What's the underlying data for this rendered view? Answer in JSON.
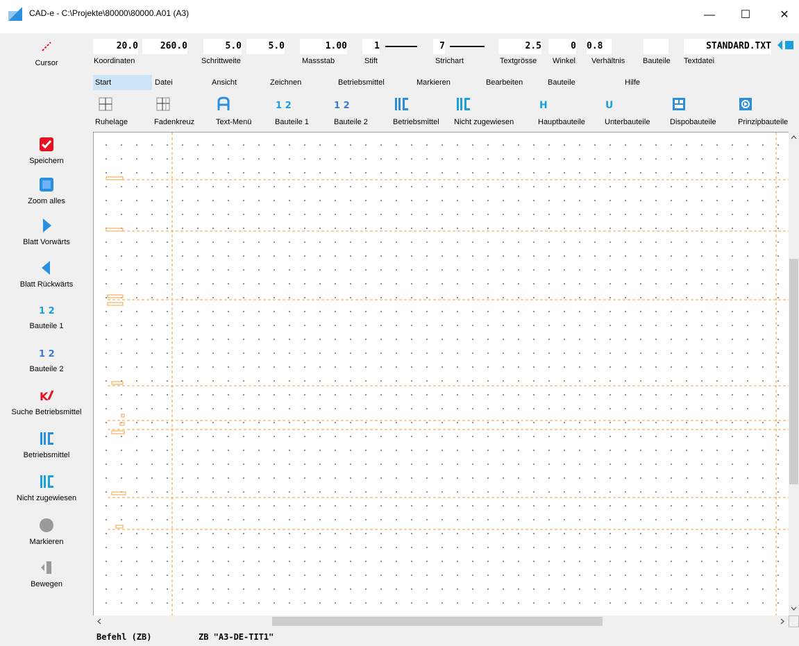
{
  "window": {
    "title": "CAD-e - C:\\Projekte\\80000\\80000.A01 (A3)",
    "minimize": "—",
    "maximize": "☐",
    "close": "✕"
  },
  "params": {
    "koordinaten_x": "20.0",
    "koordinaten_y": "260.0",
    "schrittweite_x": "5.0",
    "schrittweite_y": "5.0",
    "massstab": "1.00",
    "stift": "1",
    "strichart": "7",
    "textgroesse": "2.5",
    "winkel": "0",
    "verhaeltnis": "0.8",
    "bauteile": "",
    "textdatei": "STANDARD.TXT"
  },
  "param_labels": {
    "koordinaten": "Koordinaten",
    "schrittweite": "Schrittweite",
    "massstab": "Massstab",
    "stift": "Stift",
    "strichart": "Strichart",
    "textgroesse": "Textgrösse",
    "winkel": "Winkel",
    "verhaeltnis": "Verhältnis",
    "bauteile": "Bauteile",
    "textdatei": "Textdatei"
  },
  "cursor_label": "Cursor",
  "menu": [
    "Start",
    "Datei",
    "Ansicht",
    "Zeichnen",
    "Betriebsmittel",
    "Markieren",
    "Bearbeiten",
    "Bauteile",
    "Hilfe"
  ],
  "toolbar": [
    "Ruhelage",
    "Fadenkreuz",
    "Text-Menü",
    "Bauteile 1",
    "Bauteile 2",
    "Betriebsmittel",
    "Nicht zugewiesen",
    "Hauptbauteile",
    "Unterbauteile",
    "Dispobauteile",
    "Prinzipbauteile"
  ],
  "toolbar_glyphs": {
    "bauteile1": "1 2",
    "bauteile2": "1 2",
    "hauptbauteile": "H",
    "unterbauteile": "U"
  },
  "sidebar": [
    "Speichern",
    "Zoom alles",
    "Blatt Vorwärts",
    "Blatt Rückwärts",
    "Bauteile 1",
    "Bauteile 2",
    "Suche Betriebsmittel",
    "Betriebsmittel",
    "Nicht zugewiesen",
    "Markieren",
    "Bewegen"
  ],
  "sidebar_glyphs": {
    "bauteile1": "1 2",
    "bauteile2": "1 2",
    "suche": "K"
  },
  "status": {
    "command": "Befehl (ZB)",
    "value": "ZB \"A3-DE-TIT1\""
  },
  "colors": {
    "accent_blue": "#2b8fe0",
    "icon_blue": "#3a7bd5",
    "cyan": "#1aa0e0",
    "red": "#e81123",
    "orange": "#f0a040",
    "gray": "#9a9a9a"
  }
}
